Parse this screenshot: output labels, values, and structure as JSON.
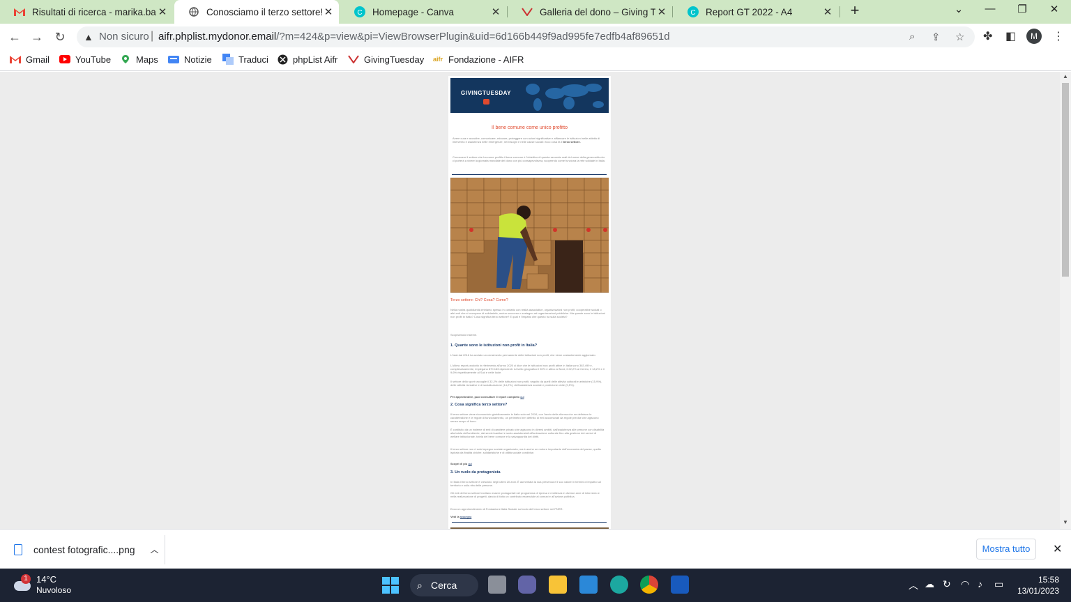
{
  "tabs": [
    {
      "title": "Risultati di ricerca - marika.bastia",
      "icon": "gmail-icon"
    },
    {
      "title": "Conosciamo il terzo settore!",
      "icon": "globe-icon"
    },
    {
      "title": "Homepage - Canva",
      "icon": "canva-icon"
    },
    {
      "title": "Galleria del dono – Giving Tuesda",
      "icon": "givingtuesday-icon"
    },
    {
      "title": "Report GT 2022 - A4",
      "icon": "canva-icon"
    }
  ],
  "address": {
    "security": "Non sicuro",
    "host": "aifr.phplist.mydonor.email",
    "path": "/?m=424&p=view&pi=ViewBrowserPlugin&uid=6d166b449f9ad995fe7edfb4af89651d"
  },
  "profile_initial": "M",
  "bookmarks": [
    "Gmail",
    "YouTube",
    "Maps",
    "Notizie",
    "Traduci",
    "phpList Aifr",
    "GivingTuesday",
    "Fondazione - AIFR"
  ],
  "email": {
    "logo": "GIVINGTUESDAY",
    "title": "Il bene comune come unico profitto",
    "intro1": "Avere cura e accudire, comunicare, educare, proteggere con azioni significative e affiancare le istituzioni nelle attività di intervento e assistenza nelle emergenze, nei bisogni e nelle cause sociali: ecco cosa fa il",
    "intro1_bold": "terzo settore.",
    "intro2": "Conoscere il settore che ha come profitto il bene comune è l'obiettivo di questa seconda mail del mese della generosità che ci porterà a vivere la giornata mondiale del dono con più consapevolezza, scoprendo come funziona la rete solidale in Italia.",
    "section_title": "Terzo settore: Chi? Cosa? Come?",
    "p1": "Nella nostra quotidianità entriamo spesso in contatto con realtà associative, organizzazioni non profit, cooperative sociali o altri enti che si occupano di solidarietà, mutuo soccorso o sostegno ad organizzazioni pubbliche. Ma quante sono le istituzioni non profit in Italia? Cosa significa terzo settore? E qual è l'impatto che questo ha sulla società?",
    "p2": "Scopriamolo insieme.",
    "h1": "1. Quante sono le istituzioni non profit in Italia?",
    "p3": "L'Istat dal 2016 ha avviato un censimento permanente delle istituzioni non profit, che viene costantemente aggiornato.",
    "p4": "L'ultimo report prodotto in riferimento all'anno 2020 ci dice che le istituzioni non profit attive in Italia sono 363.499 e, complessivamente, impiegano 870.183 dipendenti. A livello geografico il 50% è attivo al Nord, il 22,2% al Centro, il 18,2% e il 9,6% rispettivamente al Sud e nelle Isole.",
    "p5": "Il settore dello sport raccoglie il 32,2% delle istituzioni non profit, seguito da quelli delle attività culturali e artistiche (15,9%), delle attività ricreative e di socializzazione (14,2%), dell'assistenza sociale e protezione civile (9,5%).",
    "p6": "Per approfondire, puoi consultare il report completo",
    "p6_link": "qui",
    "h2": "2. Cosa significa terzo settore?",
    "p7": "Il terzo settore viene riconosciuto giuridicamente in Italia solo nel 2016, con l'avvio della riforma che ne definisce le caratteristiche e le regole di funzionamento, un perimetro ben definito di enti accomunati da regole precise che agiscono senza scopo di lucro.",
    "p8": "È costituito da un insieme di enti di carattere privato che agiscono in diversi ambiti, dall'assistenza alle persone con disabilità alla tutela dell'ambiente, dai servizi sanitari e socio-assistenziali all'animazione culturale fino alla gestione dei servizi di welfare istituzionale, tutela del bene comune e la salvaguardia dei diritti.",
    "p9": "Il terzo settore non è solo impegno sociale organizzato, ma è anche un motore importante dell'economia del paese, quella ispirata da finalità civiche, solidaristiche e di utilità sociale condivise.",
    "p10": "Scopri di più",
    "p10_link": "qui",
    "h3": "3. Un ruolo da protagonista",
    "p11": "In Italia il terzo settore è cresciuto negli ultimi 20 anni. È aumentata la sua presenza e il suo valore in termini di impatto sul territorio e sulla vita delle persone.",
    "p12": "Gli enti del terzo settore trovilano essere protagonisti nel programma di ripresa e resilienza in diverse aree di intervento e nella realizzazione di progetti, dando di fatto un contributo essenziale al comuni e all'azione pubblica.",
    "p13": "Ecco un approfondimento di Fondazione Italia Sociale sul ruolo del terzo settore nel PNRR.",
    "p14": "Vedi la",
    "p14_link": "rassegna"
  },
  "download": {
    "filename": "contest fotografic....png",
    "show_all": "Mostra tutto"
  },
  "taskbar": {
    "temp": "14°C",
    "weather": "Nuvoloso",
    "badge": "1",
    "search": "Cerca",
    "time": "15:58",
    "date": "13/01/2023"
  },
  "colors": {
    "tabstrip": "#cfe7c4",
    "accent": "#e04a2e",
    "navy": "#13365e",
    "link": "#1a73e8"
  }
}
